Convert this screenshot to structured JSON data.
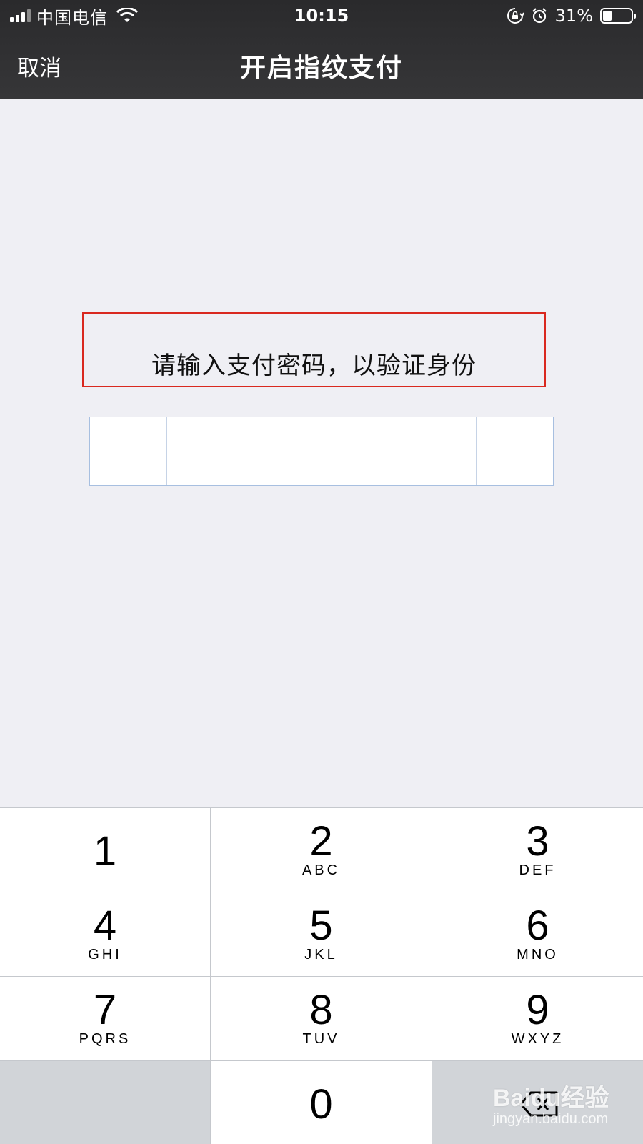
{
  "status_bar": {
    "carrier": "中国电信",
    "time": "10:15",
    "battery_percent": "31%",
    "battery_level": 0.31,
    "signal_bars": 3,
    "icons": [
      "signal-icon",
      "wifi-icon",
      "rotation-lock-icon",
      "alarm-icon",
      "battery-icon"
    ]
  },
  "nav": {
    "cancel_label": "取消",
    "title": "开启指纹支付"
  },
  "prompt": {
    "text": "请输入支付密码，以验证身份",
    "highlight_color": "#d9281f"
  },
  "pin": {
    "length": 6,
    "value": ""
  },
  "keypad": {
    "keys": [
      {
        "digit": "1",
        "letters": ""
      },
      {
        "digit": "2",
        "letters": "ABC"
      },
      {
        "digit": "3",
        "letters": "DEF"
      },
      {
        "digit": "4",
        "letters": "GHI"
      },
      {
        "digit": "5",
        "letters": "JKL"
      },
      {
        "digit": "6",
        "letters": "MNO"
      },
      {
        "digit": "7",
        "letters": "PQRS"
      },
      {
        "digit": "8",
        "letters": "TUV"
      },
      {
        "digit": "9",
        "letters": "WXYZ"
      },
      {
        "digit": "0",
        "letters": ""
      }
    ],
    "delete_icon": "delete-backspace-icon"
  },
  "watermark": {
    "brand": "Baidu经验",
    "url": "jingyan.baidu.com"
  }
}
